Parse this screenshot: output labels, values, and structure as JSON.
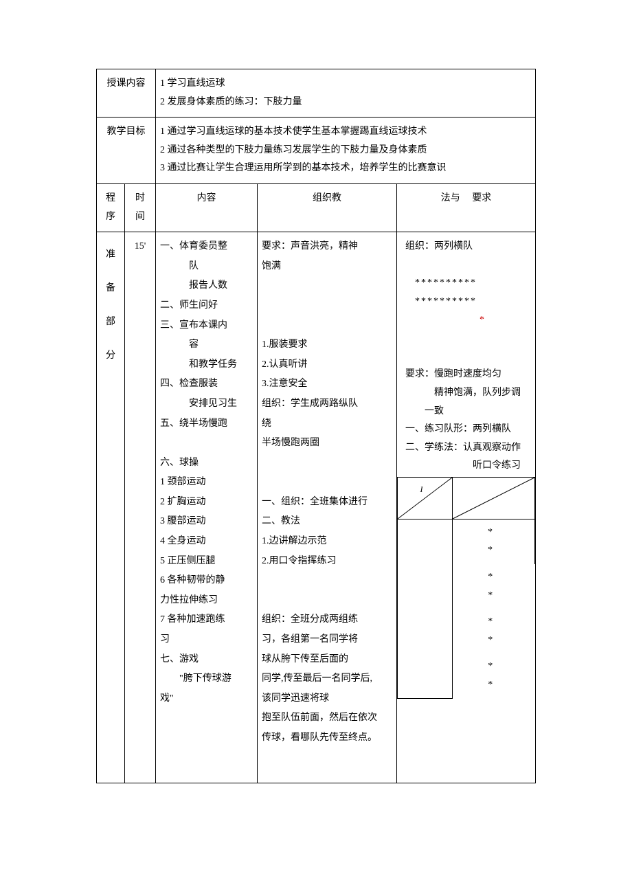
{
  "row1": {
    "label": "授课内容",
    "line1": "1 学习直线运球",
    "line2": "2 发展身体素质的练习：下肢力量"
  },
  "row2": {
    "label": "教学目标",
    "line1": "1 通过学习直线运球的基本技术使学生基本掌握踢直线运球技术",
    "line2": "2 通过各种类型的下肢力量练习发展学生的下肢力量及身体素质",
    "line3": "3 通过比赛让学生合理运用所学到的基本技术，培养学生的比赛意识"
  },
  "header": {
    "seq1": "程",
    "seq2": "序",
    "time1": "时",
    "time2": "间",
    "content": "内容",
    "org": "组织教",
    "method": "法与",
    "req": "要求"
  },
  "prep": {
    "seq": [
      "准",
      "备",
      "部",
      "分"
    ],
    "time": "15'",
    "content": {
      "i1a": "一、体育委员整",
      "i1b": "　　　队",
      "i1c": "　　　报告人数",
      "i2": "二、师生问好",
      "i3a": "三、宣布本课内",
      "i3b": "　　　容",
      "i3c": "　　　和教学任务",
      "i4a": "四、检查服装",
      "i4b": "　　　安排见习生",
      "i5a": "五、绕半场慢跑",
      "i5b": "",
      "i6": "六、球操",
      "e1": "1 颈部运动",
      "e2": "2 扩胸运动",
      "e3": "3 腰部运动",
      "e4": "4 全身运动",
      "e5": "5 正压侧压腿",
      "e6": "6 各种韧带的静",
      "e6b": "力性拉伸练习",
      "e7": "7 各种加速跑练",
      "e7b": "习",
      "i7a": "七、游戏",
      "i7b": "　　\"胯下传球游",
      "i7c": "戏\""
    },
    "org": {
      "r1a": "要求：声音洪亮，精神",
      "r1b": "饱满",
      "sp1": "",
      "sp2": "",
      "sp3": "",
      "d1": "1.服装要求",
      "d2": "2.认真听讲",
      "d3": "3.注意安全",
      "o1a": "组织：学生成两路纵队",
      "o1b": "绕",
      "o1c": "半场慢跑两圈",
      "sp4": "",
      "sp5": "",
      "g1a": "一、组织：全班集体进行",
      "g1b": "二、教法",
      "g1c": "1.边讲解边示范",
      "g1d": "2.用口令指挥练习",
      "sp6": "",
      "sp7": "",
      "sp8": "",
      "game1": "组织：全班分成两组练",
      "game2": "习，各组第一名同学将",
      "game3": "球从胯下传至后面的",
      "game4": "同学,传至最后一名同学后,",
      "game5": "该同学迅速将球",
      "game6": "抱至队伍前面，然后在依次",
      "game7": "传球，看哪队先传至终点。"
    },
    "method": {
      "m1": "组织：两列横队",
      "stars1": "**********",
      "stars2": "**********",
      "redstar": "*",
      "r1": "要求：慢跑时速度均匀",
      "r2": "　　　精神饱满，队列步调",
      "r3": "　　一致",
      "p1": "一、练习队形：两列横队",
      "p2": "二、学练法：认真观察动作",
      "p2b": "　　　　　　　听口令练习",
      "diag_i": "I",
      "srow1": "*　　　*",
      "srow2": "*　　　*",
      "srow3": "*　　　*",
      "srow4": "*　　　*"
    }
  }
}
